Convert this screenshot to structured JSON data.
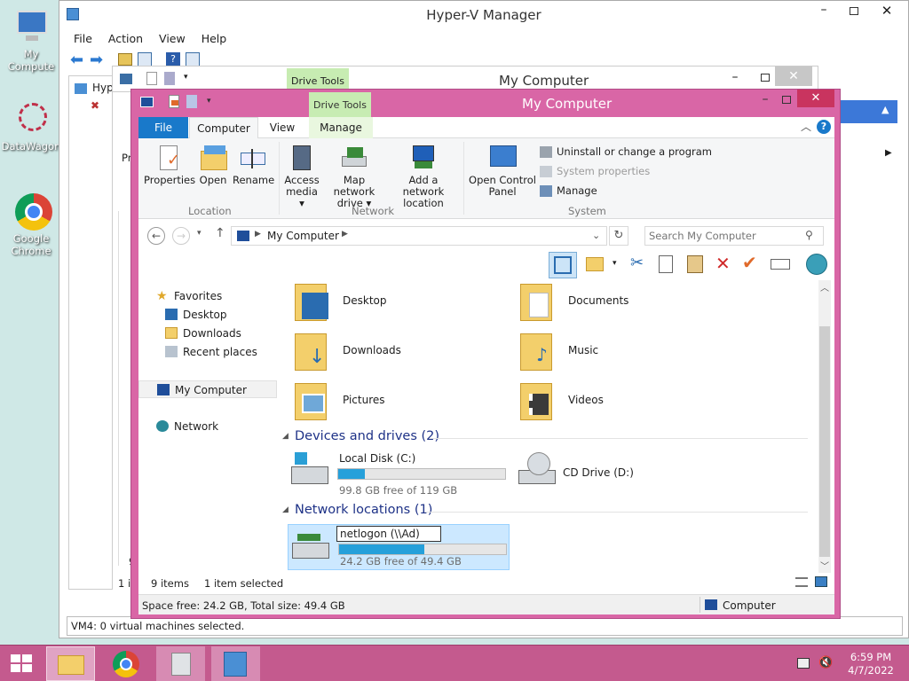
{
  "desktop": {
    "icons": [
      {
        "label": "My Compute"
      },
      {
        "label": "DataWagon"
      },
      {
        "label": "Google Chrome"
      }
    ]
  },
  "hyperv": {
    "title": "Hyper-V Manager",
    "menu": [
      "File",
      "Action",
      "View",
      "Help"
    ],
    "tree_root": "Hyp",
    "status": "VM4:  0 virtual machines selected.",
    "left_frag1": "9",
    "left_frag2": "1 it"
  },
  "back_explorer": {
    "title": "My Computer",
    "context_tab": "Drive Tools",
    "ribbon_frag": "Pr"
  },
  "explorer": {
    "title": "My Computer",
    "context_tab": "Drive Tools",
    "tabs": [
      "File",
      "Computer",
      "View",
      "Manage"
    ],
    "ribbon": {
      "location": {
        "label": "Location",
        "buttons": [
          "Properties",
          "Open",
          "Rename"
        ]
      },
      "network": {
        "label": "Network",
        "buttons": [
          "Access media",
          "Map network drive",
          "Add a network location"
        ]
      },
      "system": {
        "label": "System",
        "open_cp": "Open Control Panel",
        "uninstall": "Uninstall or change a program",
        "sysprops": "System properties",
        "manage": "Manage"
      }
    },
    "address": "My Computer",
    "search_placeholder": "Search My Computer",
    "nav": {
      "favorites": "Favorites",
      "desktop": "Desktop",
      "downloads": "Downloads",
      "recent": "Recent places",
      "computer": "My Computer",
      "network": "Network"
    },
    "folders": [
      {
        "name": "Desktop"
      },
      {
        "name": "Documents"
      },
      {
        "name": "Downloads"
      },
      {
        "name": "Music"
      },
      {
        "name": "Pictures"
      },
      {
        "name": "Videos"
      }
    ],
    "devices_header": "Devices and drives (2)",
    "local_disk": {
      "name": "Local Disk (C:)",
      "free": "99.8 GB free of 119 GB",
      "used_fraction": 0.16
    },
    "cd_drive": "CD Drive (D:)",
    "network_header": "Network locations (1)",
    "netlogon": {
      "name": "netlogon (\\\\Ad)",
      "free": "24.2 GB free of 49.4 GB",
      "used_fraction": 0.51
    },
    "items_count": "9 items",
    "selected": "1 item selected",
    "status_left": "Space free: 24.2 GB, Total size: 49.4 GB",
    "status_right": "Computer"
  },
  "taskbar": {
    "time": "6:59 PM",
    "date": "4/7/2022"
  },
  "colors": {
    "accent_pink": "#d966a6",
    "ribbon_blue": "#1979ca",
    "progress": "#26a0da",
    "taskbar": "#c45a8e"
  }
}
